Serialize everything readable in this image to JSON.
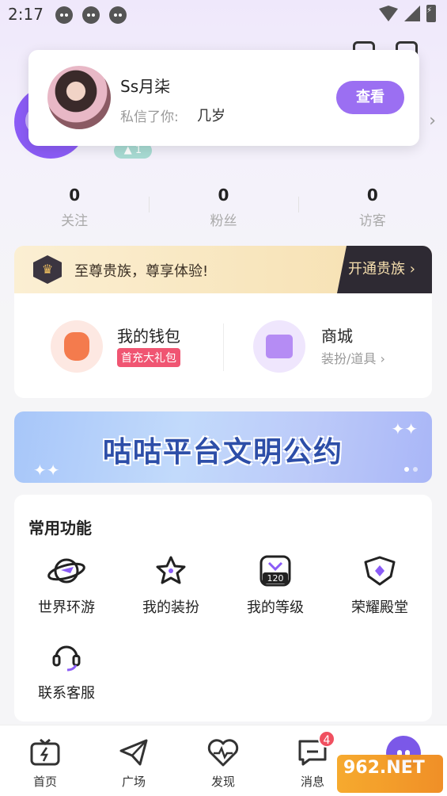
{
  "status_bar": {
    "time": "2:17"
  },
  "notification": {
    "name": "Ss月柒",
    "label": "私信了你:",
    "message": "几岁",
    "view_button": "查看"
  },
  "profile": {
    "level": "1"
  },
  "stats": [
    {
      "value": "0",
      "label": "关注"
    },
    {
      "value": "0",
      "label": "粉丝"
    },
    {
      "value": "0",
      "label": "访客"
    }
  ],
  "vip": {
    "text": "至尊贵族，尊享体验!",
    "button": "开通贵族 ›"
  },
  "wallet": {
    "title": "我的钱包",
    "tag": "首充大礼包"
  },
  "shop": {
    "title": "商城",
    "subtitle": "装扮/道具 ›"
  },
  "banner": {
    "text": "咕咕平台文明公约"
  },
  "functions": {
    "title": "常用功能",
    "items": [
      {
        "label": "世界环游",
        "icon": "planet-plane-icon"
      },
      {
        "label": "我的装扮",
        "icon": "star-icon"
      },
      {
        "label": "我的等级",
        "icon": "level-badge-icon",
        "badge": "120"
      },
      {
        "label": "荣耀殿堂",
        "icon": "shield-icon"
      },
      {
        "label": "联系客服",
        "icon": "headset-icon"
      }
    ]
  },
  "nav": {
    "items": [
      {
        "label": "首页",
        "icon": "tv-icon"
      },
      {
        "label": "广场",
        "icon": "paper-plane-icon"
      },
      {
        "label": "发现",
        "icon": "heartbeat-icon"
      },
      {
        "label": "消息",
        "icon": "message-icon",
        "badge": "4"
      }
    ]
  },
  "watermark": {
    "text": "962.NET"
  },
  "colors": {
    "accent": "#9b6ff2",
    "badge": "#f05060",
    "vip_dark": "#2e2a33"
  }
}
